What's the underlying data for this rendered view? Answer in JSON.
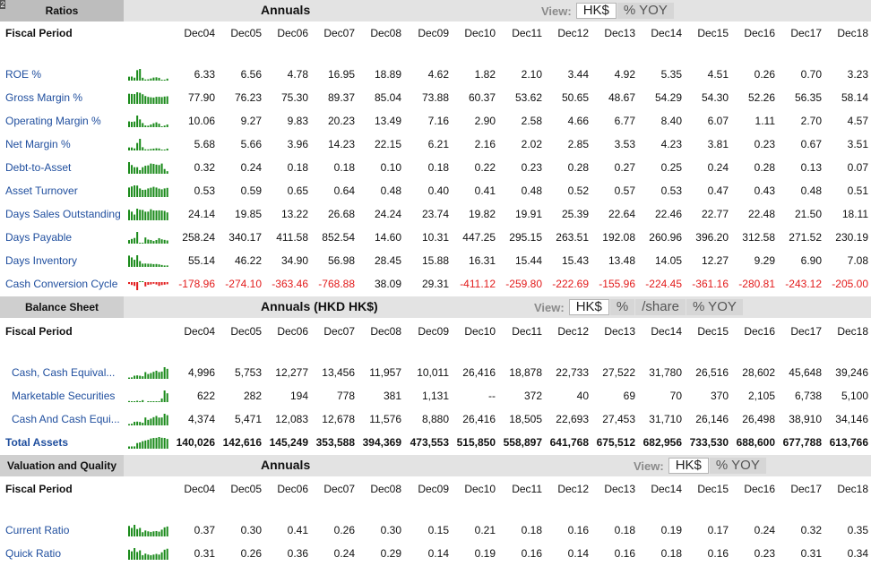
{
  "periods": [
    "Dec04",
    "Dec05",
    "Dec06",
    "Dec07",
    "Dec08",
    "Dec09",
    "Dec10",
    "Dec11",
    "Dec12",
    "Dec13",
    "Dec14",
    "Dec15",
    "Dec16",
    "Dec17",
    "Dec18"
  ],
  "fiscal_period_label": "Fiscal Period",
  "colors": {
    "link": "#1f4e9e",
    "negative": "#e21b1b",
    "spark_pos": "#1a8a1a",
    "spark_neg": "#e21b1b"
  },
  "ratios": {
    "tab": "Ratios",
    "corner": "2",
    "title": "Annuals",
    "view_label": "View:",
    "view_options": [
      "HK$",
      "% YOY"
    ],
    "rows": [
      {
        "label": "ROE %",
        "values": [
          "6.33",
          "6.56",
          "4.78",
          "16.95",
          "18.89",
          "4.62",
          "1.82",
          "2.10",
          "3.44",
          "4.92",
          "5.35",
          "4.51",
          "0.26",
          "0.70",
          "3.23"
        ]
      },
      {
        "label": "Gross Margin %",
        "values": [
          "77.90",
          "76.23",
          "75.30",
          "89.37",
          "85.04",
          "73.88",
          "60.37",
          "53.62",
          "50.65",
          "48.67",
          "54.29",
          "54.30",
          "52.26",
          "56.35",
          "58.14"
        ]
      },
      {
        "label": "Operating Margin %",
        "values": [
          "10.06",
          "9.27",
          "9.83",
          "20.23",
          "13.49",
          "7.16",
          "2.90",
          "2.58",
          "4.66",
          "6.77",
          "8.40",
          "6.07",
          "1.11",
          "2.70",
          "4.57"
        ]
      },
      {
        "label": "Net Margin %",
        "values": [
          "5.68",
          "5.66",
          "3.96",
          "14.23",
          "22.15",
          "6.21",
          "2.16",
          "2.02",
          "2.85",
          "3.53",
          "4.23",
          "3.81",
          "0.23",
          "0.67",
          "3.51"
        ]
      },
      {
        "label": "Debt-to-Asset",
        "values": [
          "0.32",
          "0.24",
          "0.18",
          "0.18",
          "0.10",
          "0.18",
          "0.22",
          "0.23",
          "0.28",
          "0.27",
          "0.25",
          "0.24",
          "0.28",
          "0.13",
          "0.07"
        ]
      },
      {
        "label": "Asset Turnover",
        "values": [
          "0.53",
          "0.59",
          "0.65",
          "0.64",
          "0.48",
          "0.40",
          "0.41",
          "0.48",
          "0.52",
          "0.57",
          "0.53",
          "0.47",
          "0.43",
          "0.48",
          "0.51"
        ]
      },
      {
        "label": "Days Sales Outstanding",
        "values": [
          "24.14",
          "19.85",
          "13.22",
          "26.68",
          "24.24",
          "23.74",
          "19.82",
          "19.91",
          "25.39",
          "22.64",
          "22.46",
          "22.77",
          "22.48",
          "21.50",
          "18.11"
        ]
      },
      {
        "label": "Days Payable",
        "values": [
          "258.24",
          "340.17",
          "411.58",
          "852.54",
          "14.60",
          "10.31",
          "447.25",
          "295.15",
          "263.51",
          "192.08",
          "260.96",
          "396.20",
          "312.58",
          "271.52",
          "230.19"
        ]
      },
      {
        "label": "Days Inventory",
        "values": [
          "55.14",
          "46.22",
          "34.90",
          "56.98",
          "28.45",
          "15.88",
          "16.31",
          "15.44",
          "15.43",
          "13.48",
          "14.05",
          "12.27",
          "9.29",
          "6.90",
          "7.08"
        ]
      },
      {
        "label": "Cash Conversion Cycle",
        "values": [
          "-178.96",
          "-274.10",
          "-363.46",
          "-768.88",
          "38.09",
          "29.31",
          "-411.12",
          "-259.80",
          "-222.69",
          "-155.96",
          "-224.45",
          "-361.16",
          "-280.81",
          "-243.12",
          "-205.00"
        ]
      }
    ]
  },
  "balance": {
    "tab": "Balance Sheet",
    "title": "Annuals (HKD HK$)",
    "view_label": "View:",
    "view_options": [
      "HK$",
      "%",
      "/share",
      "% YOY"
    ],
    "rows": [
      {
        "label": "Cash, Cash Equival...",
        "values": [
          "4,996",
          "5,753",
          "12,277",
          "13,456",
          "11,957",
          "10,011",
          "26,416",
          "18,878",
          "22,733",
          "27,522",
          "31,780",
          "26,516",
          "28,602",
          "45,648",
          "39,246"
        ]
      },
      {
        "label": "Marketable Securities",
        "values": [
          "622",
          "282",
          "194",
          "778",
          "381",
          "1,131",
          "--",
          "372",
          "40",
          "69",
          "70",
          "370",
          "2,105",
          "6,738",
          "5,100"
        ]
      },
      {
        "label": "Cash And Cash Equi...",
        "values": [
          "4,374",
          "5,471",
          "12,083",
          "12,678",
          "11,576",
          "8,880",
          "26,416",
          "18,505",
          "22,693",
          "27,453",
          "31,710",
          "26,146",
          "26,498",
          "38,910",
          "34,146"
        ]
      },
      {
        "label": "Total Assets",
        "values": [
          "140,026",
          "142,616",
          "145,249",
          "353,588",
          "394,369",
          "473,553",
          "515,850",
          "558,897",
          "641,768",
          "675,512",
          "682,956",
          "733,530",
          "688,600",
          "677,788",
          "613,766"
        ]
      }
    ]
  },
  "valuation": {
    "tab": "Valuation and Quality",
    "title": "Annuals",
    "view_label": "View:",
    "view_options": [
      "HK$",
      "% YOY"
    ],
    "rows": [
      {
        "label": "Current Ratio",
        "values": [
          "0.37",
          "0.30",
          "0.41",
          "0.26",
          "0.30",
          "0.15",
          "0.21",
          "0.18",
          "0.16",
          "0.18",
          "0.19",
          "0.17",
          "0.24",
          "0.32",
          "0.35"
        ]
      },
      {
        "label": "Quick Ratio",
        "values": [
          "0.31",
          "0.26",
          "0.36",
          "0.24",
          "0.29",
          "0.14",
          "0.19",
          "0.16",
          "0.14",
          "0.16",
          "0.18",
          "0.16",
          "0.23",
          "0.31",
          "0.34"
        ]
      }
    ]
  }
}
